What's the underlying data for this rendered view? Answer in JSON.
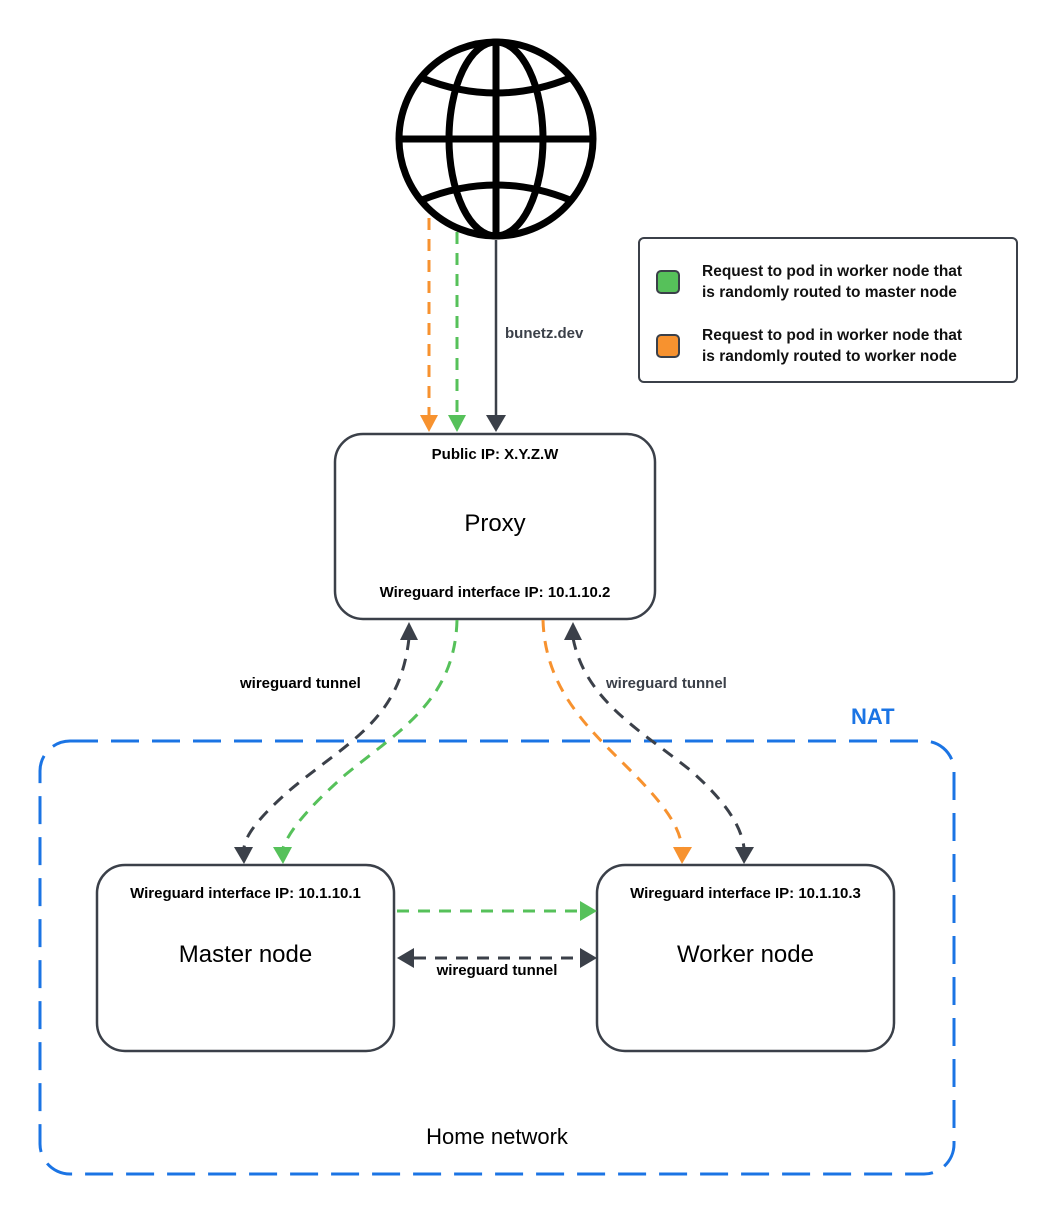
{
  "colors": {
    "green": "#56c15a",
    "orange": "#f7922f",
    "dark": "#3b4049",
    "nat_blue": "#1b74e4"
  },
  "globe": {
    "icon": "globe-icon"
  },
  "edges": {
    "domain_label": "bunetz.dev",
    "tunnel_left_label": "wireguard tunnel",
    "tunnel_right_label": "wireguard tunnel",
    "tunnel_bottom_label": "wireguard tunnel"
  },
  "proxy": {
    "public_ip": "Public IP: X.Y.Z.W",
    "title": "Proxy",
    "wg_ip": "Wireguard interface IP: 10.1.10.2"
  },
  "master": {
    "wg_ip": "Wireguard interface IP: 10.1.10.1",
    "title": "Master node"
  },
  "worker": {
    "wg_ip": "Wireguard interface IP: 10.1.10.3",
    "title": "Worker node"
  },
  "nat": {
    "label": "NAT",
    "region_label": "Home network"
  },
  "legend": {
    "items": [
      {
        "color": "green",
        "line1": "Request to pod in worker node that",
        "line2": "is randomly routed to master node"
      },
      {
        "color": "orange",
        "line1": "Request to pod in worker node that",
        "line2": "is randomly routed to worker node"
      }
    ]
  }
}
